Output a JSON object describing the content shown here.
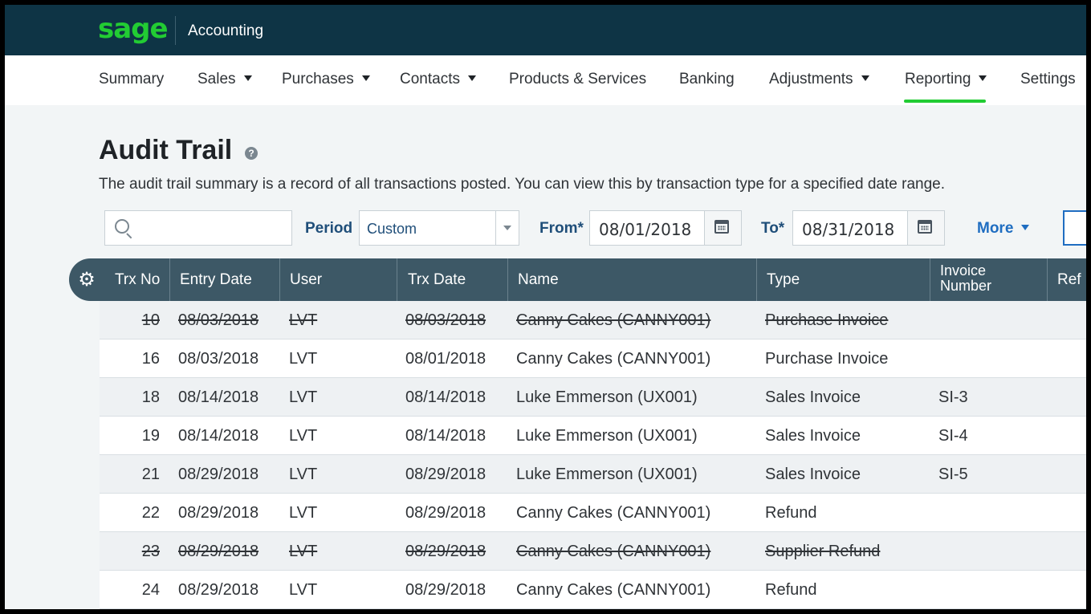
{
  "app": {
    "brand": "sage",
    "product": "Accounting"
  },
  "nav": [
    {
      "label": "Summary",
      "dropdown": false
    },
    {
      "label": "Sales",
      "dropdown": true
    },
    {
      "label": "Purchases",
      "dropdown": true
    },
    {
      "label": "Contacts",
      "dropdown": true
    },
    {
      "label": "Products & Services",
      "dropdown": false
    },
    {
      "label": "Banking",
      "dropdown": false
    },
    {
      "label": "Adjustments",
      "dropdown": true
    },
    {
      "label": "Reporting",
      "dropdown": true,
      "active": true
    },
    {
      "label": "Settings",
      "dropdown": false
    }
  ],
  "page": {
    "title": "Audit Trail",
    "help_icon": "?",
    "subtitle": "The audit trail summary is a record of all transactions posted. You can view this by transaction type for a specified date range."
  },
  "filters": {
    "search_placeholder": "",
    "period_label": "Period",
    "period_value": "Custom",
    "from_label": "From*",
    "from_value": "08/01/2018",
    "to_label": "To*",
    "to_value": "08/31/2018",
    "more_label": "More"
  },
  "table": {
    "columns": [
      "Trx No",
      "Entry Date",
      "User",
      "Trx Date",
      "Name",
      "Type",
      "Invoice Number",
      "Ref"
    ],
    "rows": [
      {
        "trx_no": "10",
        "entry_date": "08/03/2018",
        "user": "LVT",
        "trx_date": "08/03/2018",
        "name": "Canny Cakes (CANNY001)",
        "type": "Purchase Invoice",
        "invoice": "",
        "voided": true
      },
      {
        "trx_no": "16",
        "entry_date": "08/03/2018",
        "user": "LVT",
        "trx_date": "08/01/2018",
        "name": "Canny Cakes (CANNY001)",
        "type": "Purchase Invoice",
        "invoice": "",
        "voided": false
      },
      {
        "trx_no": "18",
        "entry_date": "08/14/2018",
        "user": "LVT",
        "trx_date": "08/14/2018",
        "name": "Luke Emmerson (UX001)",
        "type": "Sales Invoice",
        "invoice": "SI-3",
        "voided": false
      },
      {
        "trx_no": "19",
        "entry_date": "08/14/2018",
        "user": "LVT",
        "trx_date": "08/14/2018",
        "name": "Luke Emmerson (UX001)",
        "type": "Sales Invoice",
        "invoice": "SI-4",
        "voided": false
      },
      {
        "trx_no": "21",
        "entry_date": "08/29/2018",
        "user": "LVT",
        "trx_date": "08/29/2018",
        "name": "Luke Emmerson (UX001)",
        "type": "Sales Invoice",
        "invoice": "SI-5",
        "voided": false
      },
      {
        "trx_no": "22",
        "entry_date": "08/29/2018",
        "user": "LVT",
        "trx_date": "08/29/2018",
        "name": "Canny Cakes (CANNY001)",
        "type": "Refund",
        "invoice": "",
        "voided": false
      },
      {
        "trx_no": "23",
        "entry_date": "08/29/2018",
        "user": "LVT",
        "trx_date": "08/29/2018",
        "name": "Canny Cakes (CANNY001)",
        "type": "Supplier Refund",
        "invoice": "",
        "voided": true
      },
      {
        "trx_no": "24",
        "entry_date": "08/29/2018",
        "user": "LVT",
        "trx_date": "08/29/2018",
        "name": "Canny Cakes (CANNY001)",
        "type": "Refund",
        "invoice": "",
        "voided": false
      }
    ]
  },
  "colors": {
    "brand_green": "#22cc33",
    "topbar": "#0e3445",
    "table_header": "#3d5866",
    "link_blue": "#1f6dc1"
  }
}
